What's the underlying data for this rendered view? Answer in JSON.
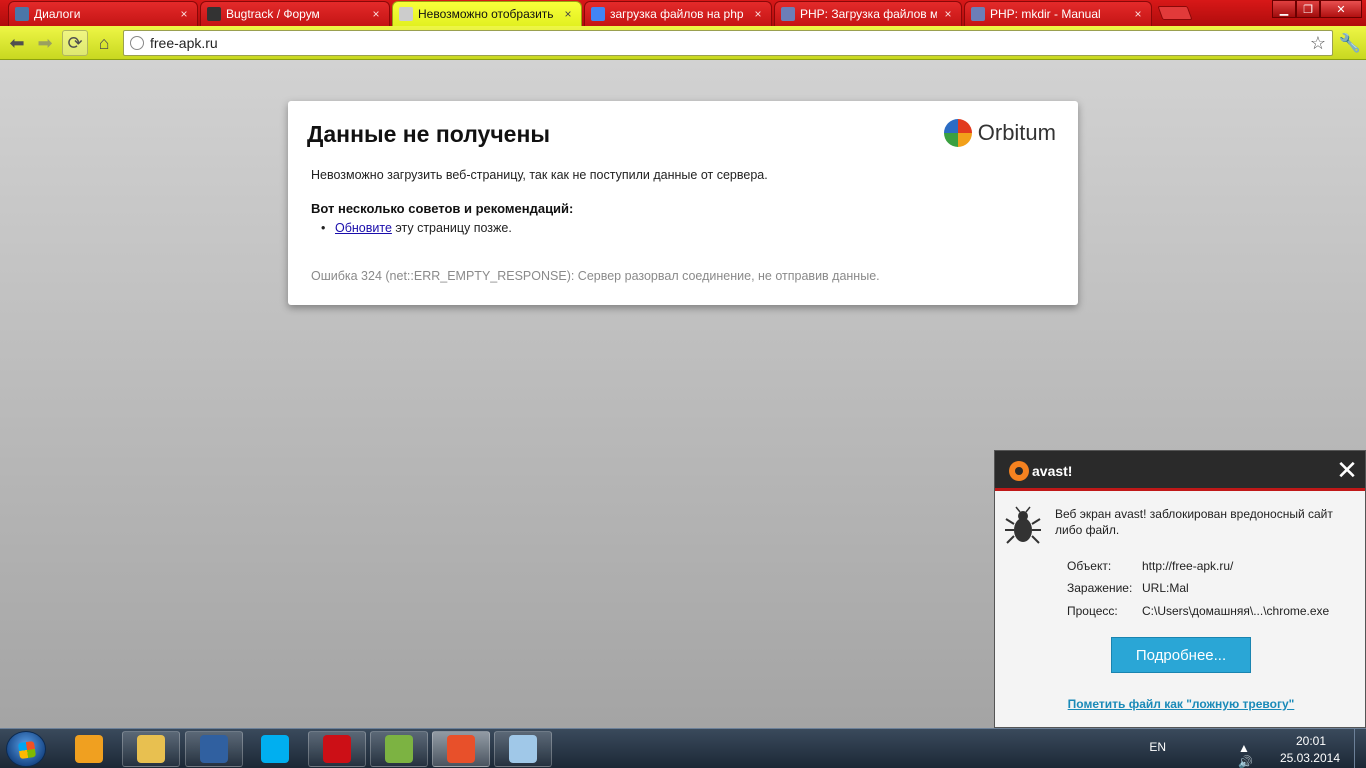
{
  "browser": {
    "tabs": [
      {
        "label": "Диалоги",
        "icon": "vk-icon",
        "color": "#4a76a8",
        "active": false
      },
      {
        "label": "Bugtrack / Форум",
        "icon": "shield-icon",
        "color": "#333333",
        "active": false
      },
      {
        "label": "Невозможно отобразить",
        "icon": "globe-icon",
        "color": "#cccccc",
        "active": true
      },
      {
        "label": "загрузка файлов на php -",
        "icon": "google-icon",
        "color": "#4285f4",
        "active": false
      },
      {
        "label": "PHP: Загрузка файлов ме",
        "icon": "php-icon",
        "color": "#6c7eb7",
        "active": false
      },
      {
        "label": "PHP: mkdir - Manual",
        "icon": "php-icon",
        "color": "#6c7eb7",
        "active": false
      }
    ],
    "close_glyph": "×",
    "url": "free-apk.ru"
  },
  "error_page": {
    "title": "Данные не получены",
    "brand": "Orbitum",
    "description": "Невозможно загрузить веб-страницу, так как не поступили данные от сервера.",
    "tips_heading": "Вот несколько советов и рекомендаций:",
    "tip_link": "Обновите",
    "tip_rest": " эту страницу позже.",
    "error_code": "Ошибка 324 (net::ERR_EMPTY_RESPONSE): Сервер разорвал соединение, не отправив данные."
  },
  "avast": {
    "logo_text": "avast!",
    "message": "Веб экран avast! заблокирован вредоносный сайт либо файл.",
    "details": [
      {
        "key": "Объект:",
        "value": "http://free-apk.ru/"
      },
      {
        "key": "Заражение:",
        "value": "URL:Mal"
      },
      {
        "key": "Процесс:",
        "value": "C:\\Users\\домашняя\\...\\chrome.exe"
      }
    ],
    "button": "Подробнее...",
    "false_alarm_link": "Пометить файл как \"ложную тревогу\"",
    "accent": "#f58220"
  },
  "taskbar": {
    "apps": [
      {
        "name": "winamp-icon",
        "color": "#f0a020",
        "active": false,
        "plain": true
      },
      {
        "name": "explorer-icon",
        "color": "#e8c050",
        "active": false,
        "plain": false
      },
      {
        "name": "kmplayer-icon",
        "color": "#3060a0",
        "active": false,
        "plain": false
      },
      {
        "name": "skype-icon",
        "color": "#00aff0",
        "active": false,
        "plain": true
      },
      {
        "name": "opera-icon",
        "color": "#cc0f16",
        "active": false,
        "plain": false
      },
      {
        "name": "notepad-icon",
        "color": "#7cb342",
        "active": false,
        "plain": false
      },
      {
        "name": "orbitum-icon",
        "color": "#e8502a",
        "active": true,
        "plain": false
      },
      {
        "name": "paint-icon",
        "color": "#a0c8e8",
        "active": false,
        "plain": false
      }
    ],
    "language": "EN",
    "time": "20:01",
    "date": "25.03.2014"
  }
}
